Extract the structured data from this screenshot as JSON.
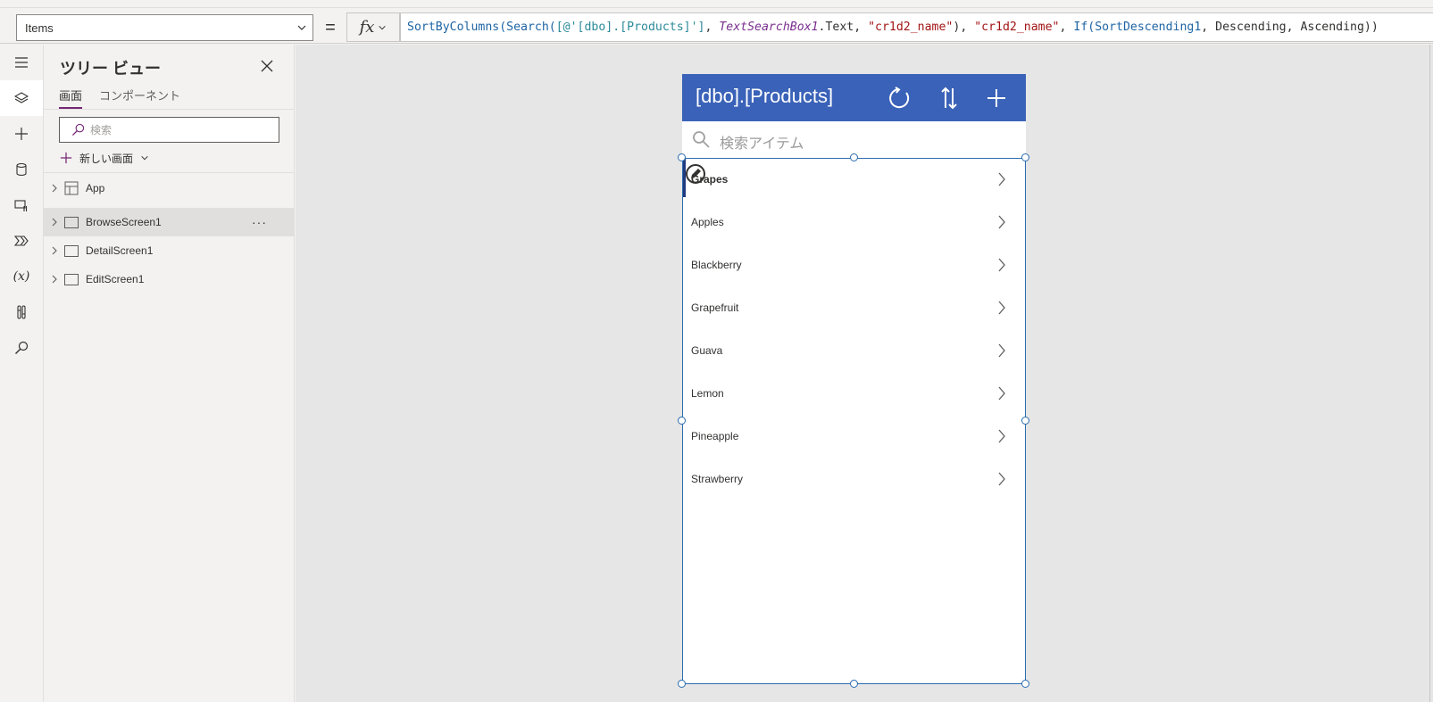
{
  "formula_bar": {
    "property": "Items",
    "equals": "=",
    "fx": "fx",
    "formula_tokens": [
      {
        "t": "SortByColumns(",
        "k": "fn"
      },
      {
        "t": "Search(",
        "k": "fn"
      },
      {
        "t": "[@'[dbo].[Products]']",
        "k": "ds"
      },
      {
        "t": ", ",
        "k": "plain"
      },
      {
        "t": "TextSearchBox1",
        "k": "ctl"
      },
      {
        "t": ".Text, ",
        "k": "plain"
      },
      {
        "t": "\"cr1d2_name\"",
        "k": "str"
      },
      {
        "t": "), ",
        "k": "plain"
      },
      {
        "t": "\"cr1d2_name\"",
        "k": "str"
      },
      {
        "t": ", ",
        "k": "plain"
      },
      {
        "t": "If(",
        "k": "fn"
      },
      {
        "t": "SortDescending1",
        "k": "fn"
      },
      {
        "t": ", Descending, Ascending))",
        "k": "plain"
      }
    ]
  },
  "rail": {
    "items": [
      {
        "name": "menu-icon"
      },
      {
        "name": "layers-icon",
        "active": true
      },
      {
        "name": "add-icon"
      },
      {
        "name": "database-icon"
      },
      {
        "name": "media-icon"
      },
      {
        "name": "power-automate-icon"
      },
      {
        "name": "variables-icon",
        "glyph": "(x)"
      },
      {
        "name": "tools-icon"
      },
      {
        "name": "search-icon"
      }
    ]
  },
  "tree": {
    "title": "ツリー ビュー",
    "tabs": [
      "画面",
      "コンポーネント"
    ],
    "search_placeholder": "検索",
    "new_screen": "新しい画面",
    "nodes": [
      {
        "label": "App",
        "icon": "app-icon"
      },
      {
        "label": "BrowseScreen1",
        "icon": "screen-icon",
        "selected": true,
        "more": "···"
      },
      {
        "label": "DetailScreen1",
        "icon": "screen-icon"
      },
      {
        "label": "EditScreen1",
        "icon": "screen-icon"
      }
    ]
  },
  "app": {
    "title": "[dbo].[Products]",
    "search_placeholder": "検索アイテム",
    "items": [
      "Grapes",
      "Apples",
      "Blackberry",
      "Grapefruit",
      "Guava",
      "Lemon",
      "Pineapple",
      "Strawberry"
    ],
    "selected_index": 0
  },
  "colors": {
    "appbar": "#3a62b8",
    "selection": "#2b6cb0",
    "accent": "#742774"
  }
}
